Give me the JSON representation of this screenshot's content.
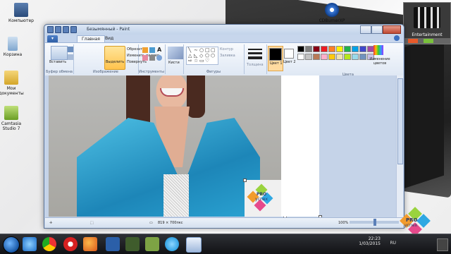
{
  "desktop": {
    "icons": [
      {
        "label": "Компьютер",
        "icon": "computer-icon"
      },
      {
        "label": "Корзина",
        "icon": "recycle-bin-icon"
      },
      {
        "label": "Мои документы",
        "icon": "folder-icon"
      },
      {
        "label": "Camtasia Studio 7",
        "icon": "camtasia-icon"
      },
      {
        "label": "CDBurnerXP",
        "icon": "cd-burner-icon"
      }
    ],
    "entertainment_tile": "Entertainment"
  },
  "paint": {
    "title": "Безымянный - Paint",
    "tabs": [
      "Главная",
      "Вид"
    ],
    "ribbon": {
      "clipboard": {
        "group": "Буфер обмена",
        "paste": "Вставить"
      },
      "image": {
        "group": "Изображение",
        "select": "Выделить",
        "crop": "Обрезать",
        "resize": "Изменить размер",
        "rotate": "Повернуть"
      },
      "tools": {
        "group": "Инструменты"
      },
      "brushes": "Кисти",
      "shapes": {
        "group": "Фигуры",
        "outline": "Контур",
        "fill": "Заливка"
      },
      "size": "Толщина",
      "color1": "Цвет 1",
      "color2": "Цвет 2",
      "colors_group": "Цвета",
      "edit_colors": "Изменение цветов"
    },
    "palette": [
      "#000000",
      "#7f7f7f",
      "#880015",
      "#ed1c24",
      "#ff7f27",
      "#fff200",
      "#22b14c",
      "#00a2e8",
      "#3f48cc",
      "#a349a4",
      "#ffffff",
      "#c3c3c3",
      "#b97a57",
      "#ffaec9",
      "#ffc90e",
      "#efe4b0",
      "#b5e61d",
      "#99d9ea",
      "#7092be",
      "#c8bfe7"
    ],
    "status": {
      "size": "819 × 700пкс",
      "zoom": "100%"
    },
    "watermark_text": {
      "line1": "PRO",
      "line2": "успех"
    }
  },
  "taskbar": {
    "lang": "RU",
    "time": "22:23",
    "date": "1/03/2015"
  }
}
